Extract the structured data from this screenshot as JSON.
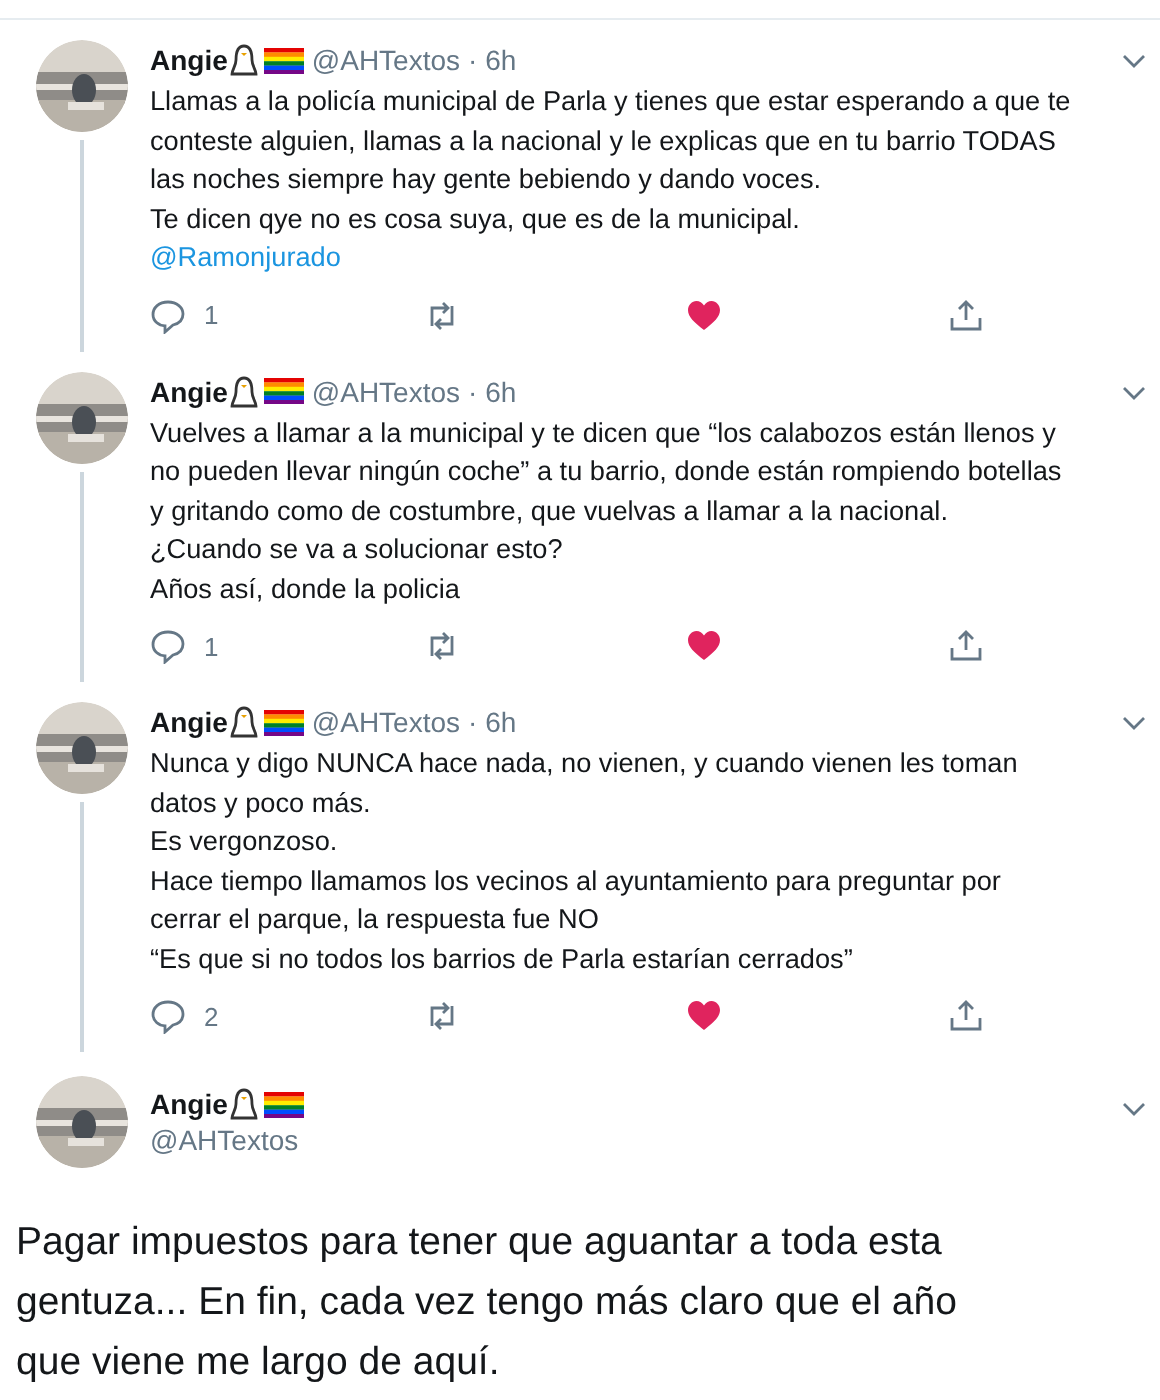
{
  "tweets": [
    {
      "kind": "reply",
      "name": "Angie",
      "handle": "@AHTextos",
      "time": "· 6h",
      "lines": [
        "Llamas a la policía municipal de Parla y tienes que estar esperando a que te",
        "conteste alguien, llamas a la nacional y le explicas que en tu barrio TODAS",
        "las noches siempre hay gente bebiendo y dando voces.",
        "Te dicen qye no es cosa suya, que es de la municipal."
      ],
      "mention": "@Ramonjurado",
      "replies": "1",
      "liked": true
    },
    {
      "kind": "reply",
      "name": "Angie",
      "handle": "@AHTextos",
      "time": "· 6h",
      "lines": [
        "Vuelves a llamar a la municipal y te dicen que “los calabozos están llenos y",
        "no pueden llevar ningún coche” a tu barrio, donde están rompiendo botellas",
        "y gritando como de costumbre, que vuelvas a llamar a la nacional.",
        "¿Cuando se va a solucionar esto?",
        "Años así, donde la policia"
      ],
      "replies": "1",
      "liked": true
    },
    {
      "kind": "reply",
      "name": "Angie",
      "handle": "@AHTextos",
      "time": "· 6h",
      "lines": [
        "Nunca y digo NUNCA hace nada, no vienen, y cuando vienen les toman",
        "datos y poco más.",
        "Es vergonzoso.",
        "Hace tiempo llamamos los vecinos al ayuntamiento para preguntar por",
        "cerrar el parque, la respuesta fue NO",
        "“Es que si no todos los barrios de Parla estarían cerrados”"
      ],
      "replies": "2",
      "liked": true
    },
    {
      "kind": "focused",
      "name": "Angie",
      "handle": "@AHTextos",
      "lines": [
        "Pagar impuestos para tener que aguantar a toda esta",
        "gentuza... En fin, cada vez tengo más claro que el año",
        "que viene me largo de aquí."
      ]
    }
  ]
}
